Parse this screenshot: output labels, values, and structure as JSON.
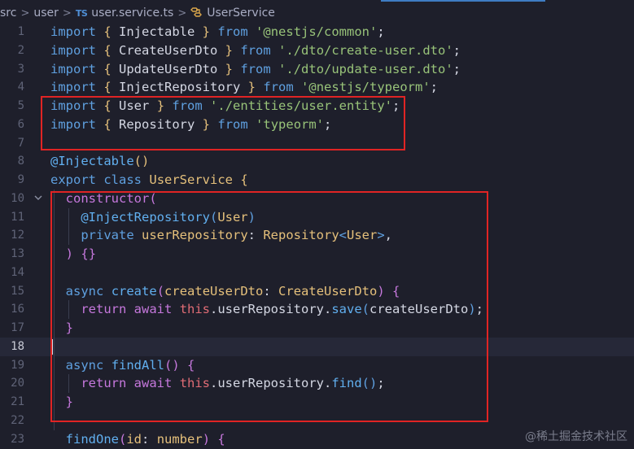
{
  "breadcrumb": {
    "items": [
      "src",
      "user",
      "user.service.ts",
      "UserService"
    ],
    "ts_badge": "TS",
    "separator": ">"
  },
  "editor": {
    "active_line": 18,
    "lines": [
      {
        "n": "1",
        "tokens": [
          [
            "kw",
            "import"
          ],
          [
            "pl",
            " "
          ],
          [
            "br1",
            "{"
          ],
          [
            "pl",
            " Injectable "
          ],
          [
            "br1",
            "}"
          ],
          [
            "pl",
            " "
          ],
          [
            "kw",
            "from"
          ],
          [
            "pl",
            " "
          ],
          [
            "st",
            "'@nestjs/common'"
          ],
          [
            "pl",
            ";"
          ]
        ]
      },
      {
        "n": "2",
        "tokens": [
          [
            "kw",
            "import"
          ],
          [
            "pl",
            " "
          ],
          [
            "br1",
            "{"
          ],
          [
            "pl",
            " CreateUserDto "
          ],
          [
            "br1",
            "}"
          ],
          [
            "pl",
            " "
          ],
          [
            "kw",
            "from"
          ],
          [
            "pl",
            " "
          ],
          [
            "st",
            "'./dto/create-user.dto'"
          ],
          [
            "pl",
            ";"
          ]
        ]
      },
      {
        "n": "3",
        "tokens": [
          [
            "kw",
            "import"
          ],
          [
            "pl",
            " "
          ],
          [
            "br1",
            "{"
          ],
          [
            "pl",
            " UpdateUserDto "
          ],
          [
            "br1",
            "}"
          ],
          [
            "pl",
            " "
          ],
          [
            "kw",
            "from"
          ],
          [
            "pl",
            " "
          ],
          [
            "st",
            "'./dto/update-user.dto'"
          ],
          [
            "pl",
            ";"
          ]
        ]
      },
      {
        "n": "4",
        "tokens": [
          [
            "kw",
            "import"
          ],
          [
            "pl",
            " "
          ],
          [
            "br1",
            "{"
          ],
          [
            "pl",
            " InjectRepository "
          ],
          [
            "br1",
            "}"
          ],
          [
            "pl",
            " "
          ],
          [
            "kw",
            "from"
          ],
          [
            "pl",
            " "
          ],
          [
            "st",
            "'@nestjs/typeorm'"
          ],
          [
            "pl",
            ";"
          ]
        ]
      },
      {
        "n": "5",
        "tokens": [
          [
            "kw",
            "import"
          ],
          [
            "pl",
            " "
          ],
          [
            "br1",
            "{"
          ],
          [
            "pl",
            " User "
          ],
          [
            "br1",
            "}"
          ],
          [
            "pl",
            " "
          ],
          [
            "kw",
            "from"
          ],
          [
            "pl",
            " "
          ],
          [
            "st",
            "'./entities/user.entity'"
          ],
          [
            "pl",
            ";"
          ]
        ]
      },
      {
        "n": "6",
        "tokens": [
          [
            "kw",
            "import"
          ],
          [
            "pl",
            " "
          ],
          [
            "br1",
            "{"
          ],
          [
            "pl",
            " Repository "
          ],
          [
            "br1",
            "}"
          ],
          [
            "pl",
            " "
          ],
          [
            "kw",
            "from"
          ],
          [
            "pl",
            " "
          ],
          [
            "st",
            "'typeorm'"
          ],
          [
            "pl",
            ";"
          ]
        ]
      },
      {
        "n": "7",
        "tokens": []
      },
      {
        "n": "8",
        "tokens": [
          [
            "dc",
            "@Injectable"
          ],
          [
            "br1",
            "()"
          ]
        ]
      },
      {
        "n": "9",
        "tokens": [
          [
            "kw",
            "export"
          ],
          [
            "pl",
            " "
          ],
          [
            "kw",
            "class"
          ],
          [
            "pl",
            " "
          ],
          [
            "ty",
            "UserService"
          ],
          [
            "pl",
            " "
          ],
          [
            "br1",
            "{"
          ]
        ]
      },
      {
        "n": "10",
        "tokens": [
          [
            "pl",
            "  "
          ],
          [
            "kw2",
            "constructor"
          ],
          [
            "br2",
            "("
          ]
        ]
      },
      {
        "n": "11",
        "tokens": [
          [
            "pl",
            "    "
          ],
          [
            "dc",
            "@InjectRepository"
          ],
          [
            "br3",
            "("
          ],
          [
            "ty",
            "User"
          ],
          [
            "br3",
            ")"
          ]
        ]
      },
      {
        "n": "12",
        "tokens": [
          [
            "pl",
            "    "
          ],
          [
            "kw",
            "private"
          ],
          [
            "pl",
            " "
          ],
          [
            "pm",
            "userRepository"
          ],
          [
            "pl",
            ": "
          ],
          [
            "ty",
            "Repository"
          ],
          [
            "br3",
            "<"
          ],
          [
            "ty",
            "User"
          ],
          [
            "br3",
            ">"
          ],
          [
            "pl",
            ","
          ]
        ]
      },
      {
        "n": "13",
        "tokens": [
          [
            "pl",
            "  "
          ],
          [
            "br2",
            ")"
          ],
          [
            "pl",
            " "
          ],
          [
            "br2",
            "{}"
          ]
        ]
      },
      {
        "n": "14",
        "tokens": []
      },
      {
        "n": "15",
        "tokens": [
          [
            "pl",
            "  "
          ],
          [
            "kw",
            "async"
          ],
          [
            "pl",
            " "
          ],
          [
            "fn",
            "create"
          ],
          [
            "br2",
            "("
          ],
          [
            "pm",
            "createUserDto"
          ],
          [
            "pl",
            ": "
          ],
          [
            "ty",
            "CreateUserDto"
          ],
          [
            "br2",
            ")"
          ],
          [
            "pl",
            " "
          ],
          [
            "br2",
            "{"
          ]
        ]
      },
      {
        "n": "16",
        "tokens": [
          [
            "pl",
            "    "
          ],
          [
            "kw2",
            "return"
          ],
          [
            "pl",
            " "
          ],
          [
            "kw2",
            "await"
          ],
          [
            "pl",
            " "
          ],
          [
            "th",
            "this"
          ],
          [
            "pl",
            ".userRepository."
          ],
          [
            "fn",
            "save"
          ],
          [
            "br3",
            "("
          ],
          [
            "pl",
            "createUserDto"
          ],
          [
            "br3",
            ")"
          ],
          [
            "pl",
            ";"
          ]
        ]
      },
      {
        "n": "17",
        "tokens": [
          [
            "pl",
            "  "
          ],
          [
            "br2",
            "}"
          ]
        ]
      },
      {
        "n": "18",
        "tokens": []
      },
      {
        "n": "19",
        "tokens": [
          [
            "pl",
            "  "
          ],
          [
            "kw",
            "async"
          ],
          [
            "pl",
            " "
          ],
          [
            "fn",
            "findAll"
          ],
          [
            "br2",
            "()"
          ],
          [
            "pl",
            " "
          ],
          [
            "br2",
            "{"
          ]
        ]
      },
      {
        "n": "20",
        "tokens": [
          [
            "pl",
            "    "
          ],
          [
            "kw2",
            "return"
          ],
          [
            "pl",
            " "
          ],
          [
            "kw2",
            "await"
          ],
          [
            "pl",
            " "
          ],
          [
            "th",
            "this"
          ],
          [
            "pl",
            ".userRepository."
          ],
          [
            "fn",
            "find"
          ],
          [
            "br3",
            "()"
          ],
          [
            "pl",
            ";"
          ]
        ]
      },
      {
        "n": "21",
        "tokens": [
          [
            "pl",
            "  "
          ],
          [
            "br2",
            "}"
          ]
        ]
      },
      {
        "n": "22",
        "tokens": []
      },
      {
        "n": "23",
        "tokens": [
          [
            "pl",
            "  "
          ],
          [
            "fn",
            "findOne"
          ],
          [
            "br2",
            "("
          ],
          [
            "pm",
            "id"
          ],
          [
            "pl",
            ": "
          ],
          [
            "ty",
            "number"
          ],
          [
            "br2",
            ")"
          ],
          [
            "pl",
            " "
          ],
          [
            "br2",
            "{"
          ]
        ]
      }
    ]
  },
  "watermark": "@稀土掘金技术社区",
  "colors": {
    "background": "#1e1f2b",
    "highlight_box": "#e02424",
    "keyword": "#5fa0e0",
    "string": "#98c379",
    "type": "#e5c07b"
  }
}
